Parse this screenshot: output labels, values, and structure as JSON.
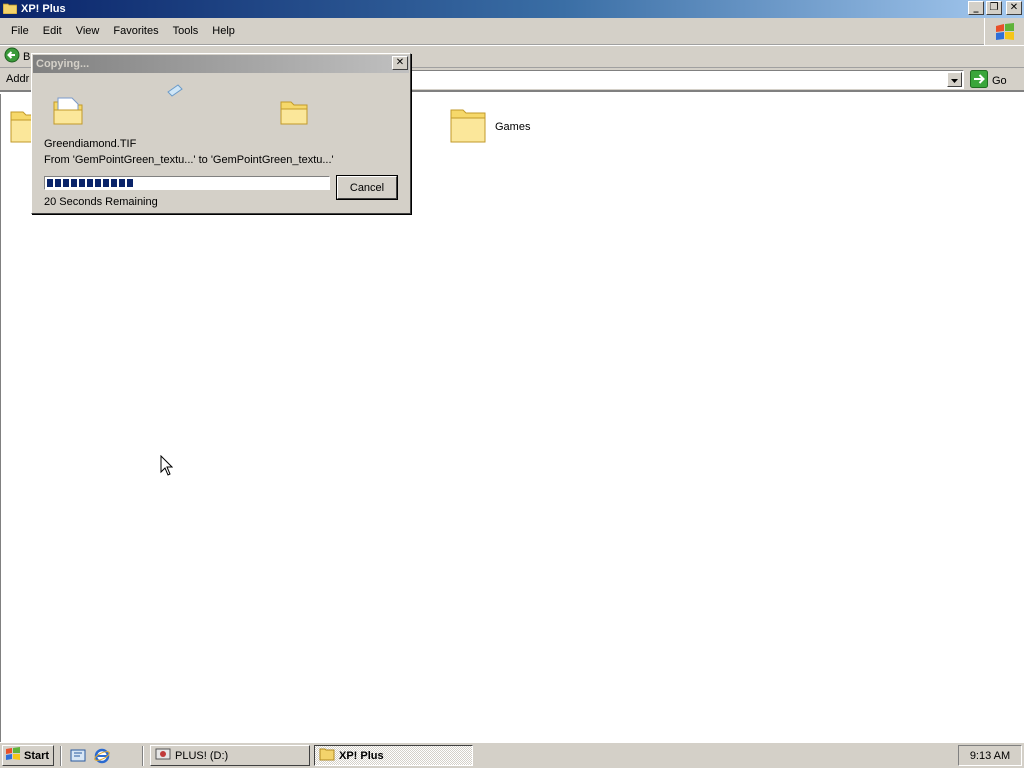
{
  "window": {
    "title": "XP! Plus",
    "caption_buttons": [
      "minimize-icon",
      "restore-icon",
      "close-icon"
    ]
  },
  "menu": {
    "items": [
      "File",
      "Edit",
      "View",
      "Favorites",
      "Tools",
      "Help"
    ]
  },
  "toolbar": {
    "back_label": "B"
  },
  "address": {
    "label": "Addr",
    "value": "",
    "go_label": "Go"
  },
  "content": {
    "folders": [
      {
        "label": ""
      },
      {
        "label": "Games"
      }
    ]
  },
  "copy_dialog": {
    "title": "Copying...",
    "filename": "Greendiamond.TIF",
    "from_to": "From 'GemPointGreen_textu...' to 'GemPointGreen_textu...'",
    "progress_percent": 31,
    "remaining": "20 Seconds Remaining",
    "cancel_label": "Cancel"
  },
  "taskbar": {
    "start_label": "Start",
    "quick_launch": [
      "desktop-icon",
      "internet-explorer-icon"
    ],
    "tasks": [
      {
        "label": "PLUS! (D:)",
        "active": false
      },
      {
        "label": "XP! Plus",
        "active": true
      }
    ],
    "clock": "9:13 AM"
  },
  "colors": {
    "titlebar_start": "#0a246a",
    "titlebar_end": "#a6caf0",
    "progress": "#0a246a",
    "chrome": "#d4d0c8"
  }
}
